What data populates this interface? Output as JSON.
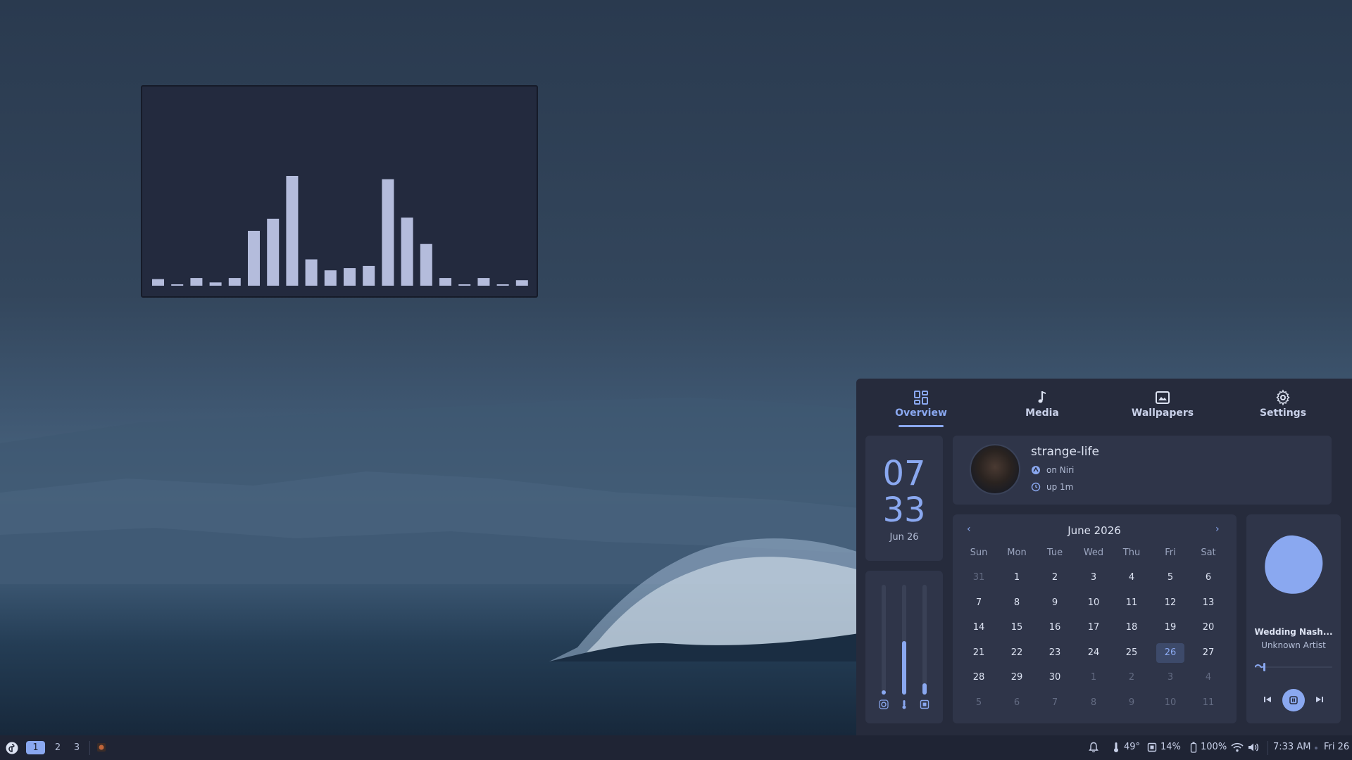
{
  "visualizer": {
    "bars": [
      0.06,
      0.01,
      0.07,
      0.03,
      0.07,
      0.5,
      0.61,
      1.0,
      0.24,
      0.14,
      0.16,
      0.18,
      0.97,
      0.62,
      0.38,
      0.07,
      0.01,
      0.07,
      0.01,
      0.05
    ]
  },
  "panel": {
    "tabs": [
      {
        "label": "Overview",
        "icon": "grid-icon",
        "active": true
      },
      {
        "label": "Media",
        "icon": "music-note-icon",
        "active": false
      },
      {
        "label": "Wallpapers",
        "icon": "wallpaper-icon",
        "active": false
      },
      {
        "label": "Settings",
        "icon": "gear-icon",
        "active": false
      }
    ],
    "clock": {
      "hours": "07",
      "minutes": "33",
      "date": "Jun 26"
    },
    "user": {
      "name": "strange-life",
      "wm": "on Niri",
      "uptime": "up 1m"
    },
    "calendar": {
      "title": "June 2026",
      "prev": "‹",
      "next": "›",
      "weekdays": [
        "Sun",
        "Mon",
        "Tue",
        "Wed",
        "Thu",
        "Fri",
        "Sat"
      ],
      "weeks": [
        [
          "31",
          "1",
          "2",
          "3",
          "4",
          "5",
          "6"
        ],
        [
          "7",
          "8",
          "9",
          "10",
          "11",
          "12",
          "13"
        ],
        [
          "14",
          "15",
          "16",
          "17",
          "18",
          "19",
          "20"
        ],
        [
          "21",
          "22",
          "23",
          "24",
          "25",
          "26",
          "27"
        ],
        [
          "28",
          "29",
          "30",
          "1",
          "2",
          "3",
          "4"
        ],
        [
          "5",
          "6",
          "7",
          "8",
          "9",
          "10",
          "11"
        ]
      ],
      "today": "26"
    },
    "sliders": [
      {
        "name": "brightness",
        "icon": "brightness-icon",
        "level": 0.02
      },
      {
        "name": "temperature",
        "icon": "thermometer-icon",
        "level": 0.49
      },
      {
        "name": "memory",
        "icon": "memory-icon",
        "level": 0.1
      }
    ],
    "media": {
      "title": "Wedding Nash...",
      "artist": "Unknown Artist",
      "progress": 0.02,
      "accent": "#8aa8f0"
    }
  },
  "taskbar": {
    "workspaces": [
      "1",
      "2",
      "3"
    ],
    "active_workspace": "1",
    "temperature": "49°",
    "memory": "14%",
    "battery": "100%",
    "time": "7:33 AM",
    "date": "Fri 26"
  },
  "colors": {
    "accent": "#8aa8f0",
    "panel": "#262b3c",
    "card": "#2f3549",
    "taskbar": "#1f2434"
  }
}
